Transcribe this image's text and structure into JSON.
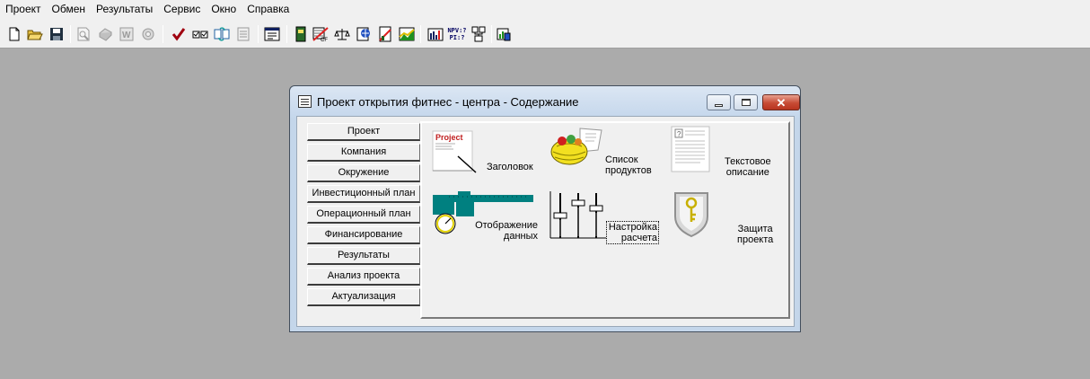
{
  "menu": [
    "Проект",
    "Обмен",
    "Результаты",
    "Сервис",
    "Окно",
    "Справка"
  ],
  "toolbar": {
    "buttons": [
      {
        "name": "new-icon"
      },
      {
        "name": "open-icon"
      },
      {
        "name": "save-icon"
      },
      {
        "name": "preview-icon"
      },
      {
        "name": "print-icon"
      },
      {
        "name": "word-icon"
      },
      {
        "name": "options-icon"
      },
      {
        "name": "check-icon"
      },
      {
        "name": "checklist-icon"
      },
      {
        "name": "refresh-icon"
      },
      {
        "name": "notes-icon"
      },
      {
        "name": "form-icon"
      },
      {
        "name": "book-icon"
      },
      {
        "name": "cashflow-icon"
      },
      {
        "name": "balance-icon"
      },
      {
        "name": "globe-icon"
      },
      {
        "name": "report-icon"
      },
      {
        "name": "chart-icon"
      },
      {
        "name": "table-chart-icon"
      },
      {
        "name": "npv-pi-icon"
      },
      {
        "name": "tree-icon"
      },
      {
        "name": "export-icon"
      }
    ],
    "npv_label": "NPV:?",
    "pi_label": "PI:?"
  },
  "window": {
    "title": "Проект открытия фитнес - центра - Содержание",
    "close_glyph": "✕"
  },
  "nav": [
    "Проект",
    "Компания",
    "Окружение",
    "Инвестиционный план",
    "Операционный план",
    "Финансирование",
    "Результаты",
    "Анализ проекта",
    "Актуализация"
  ],
  "tiles": {
    "title": {
      "label": "Заголовок",
      "icon_text": "Project"
    },
    "products": {
      "label": "Список\nпродуктов"
    },
    "text": {
      "label": "Текстовое\nописание",
      "icon_text": "?"
    },
    "display": {
      "label": "Отображение\nданных"
    },
    "calc": {
      "label": "Настройка\nрасчета"
    },
    "protect": {
      "label": "Защита\nпроекта"
    }
  },
  "colors": {
    "desktop": "#ababab",
    "window_frame": "#c4d6ea",
    "face": "#f0f0f0",
    "caliper_teal": "#008080",
    "basket_yellow": "#f2e020"
  }
}
